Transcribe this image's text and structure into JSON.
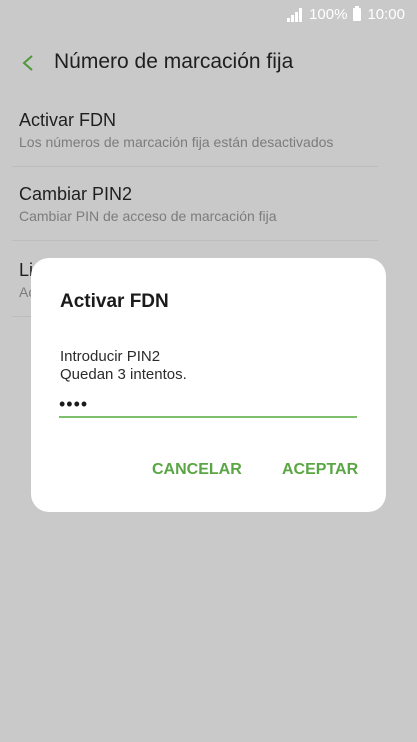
{
  "status": {
    "battery": "100%",
    "time": "10:00"
  },
  "header": {
    "title": "Número de marcación fija"
  },
  "list": {
    "items": [
      {
        "title": "Activar FDN",
        "subtitle": "Los números de marcación fija están desactivados"
      },
      {
        "title": "Cambiar PIN2",
        "subtitle": "Cambiar PIN de acceso de marcación fija"
      },
      {
        "title": "Li",
        "subtitle": "Ac"
      }
    ]
  },
  "dialog": {
    "title": "Activar FDN",
    "message_line1": "Introducir PIN2",
    "message_line2": "Quedan 3 intentos.",
    "pin_value": "••••",
    "cancel_label": "CANCELAR",
    "accept_label": "ACEPTAR"
  },
  "colors": {
    "accent": "#5aa544",
    "scrim": "#c9c9c9",
    "input_underline": "#7dbf6a"
  }
}
